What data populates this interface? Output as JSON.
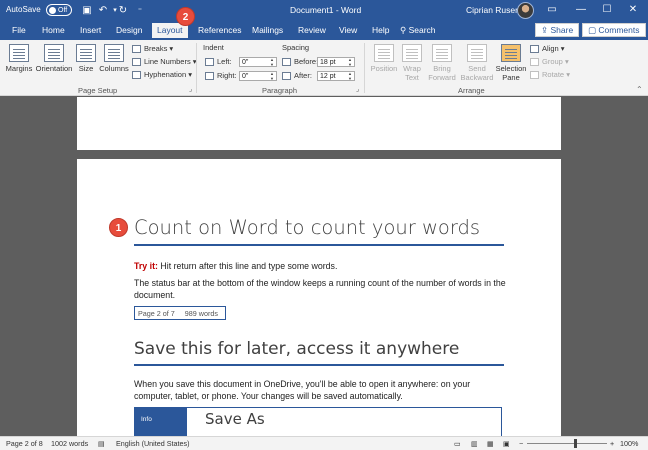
{
  "titlebar": {
    "autosave_label": "AutoSave",
    "autosave_state": "Off",
    "title": "Document1 - Word",
    "user": "Ciprian Rusen"
  },
  "tabs": [
    {
      "label": "File"
    },
    {
      "label": "Home"
    },
    {
      "label": "Insert"
    },
    {
      "label": "Design"
    },
    {
      "label": "Layout"
    },
    {
      "label": "References"
    },
    {
      "label": "Mailings"
    },
    {
      "label": "Review"
    },
    {
      "label": "View"
    },
    {
      "label": "Help"
    }
  ],
  "search_label": "Search",
  "share_label": "Share",
  "comments_label": "Comments",
  "ribbon": {
    "page_setup": {
      "label": "Page Setup",
      "margins": "Margins",
      "orientation": "Orientation",
      "size": "Size",
      "columns": "Columns",
      "breaks": "Breaks",
      "line_numbers": "Line Numbers",
      "hyphenation": "Hyphenation"
    },
    "paragraph": {
      "label": "Paragraph",
      "indent": "Indent",
      "left": "Left:",
      "right": "Right:",
      "left_value": "0\"",
      "right_value": "0\"",
      "spacing": "Spacing",
      "before": "Before:",
      "after": "After:",
      "before_value": "18 pt",
      "after_value": "12 pt"
    },
    "arrange": {
      "label": "Arrange",
      "position": "Position",
      "wrap_text_1": "Wrap",
      "wrap_text_2": "Text",
      "bring_forward_1": "Bring",
      "bring_forward_2": "Forward",
      "send_backward_1": "Send",
      "send_backward_2": "Backward",
      "selection_pane_1": "Selection",
      "selection_pane_2": "Pane",
      "align": "Align",
      "group": "Group",
      "rotate": "Rotate"
    }
  },
  "document": {
    "heading1": "Count on Word to count your words",
    "tryit_label": "Try it:",
    "tryit_text": " Hit return after this line and type some words.",
    "para1": "The status bar at the bottom of the window keeps a running count of the number of words in the document.",
    "statusbox_page": "Page 2 of 7",
    "statusbox_words": "989 words",
    "heading2": "Save this for later, access it anywhere",
    "para2": "When you save this document in OneDrive, you'll be able to open it anywhere: on your computer, tablet, or phone. Your changes will be saved automatically.",
    "saveas_side": "Info",
    "saveas_title": "Save As"
  },
  "badges": {
    "one": "1",
    "two": "2"
  },
  "statusbar": {
    "page": "Page 2 of 8",
    "words": "1002 words",
    "language": "English (United States)",
    "zoom": "100%",
    "minus": "−",
    "plus": "+"
  },
  "colors": {
    "accent": "#2b579a",
    "badge": "#e74c3c",
    "tryit": "#c00000"
  }
}
